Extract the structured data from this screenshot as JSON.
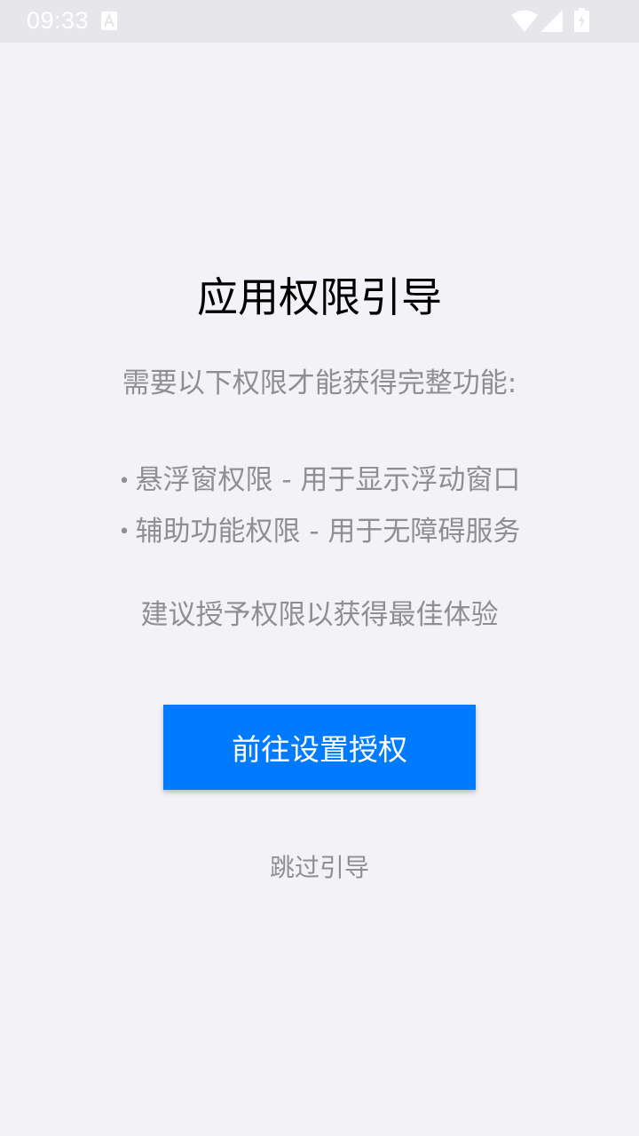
{
  "status_bar": {
    "time": "09:33",
    "icons": [
      "notification-a-icon",
      "wifi-icon",
      "signal-icon",
      "battery-icon"
    ]
  },
  "main": {
    "title": "应用权限引导",
    "subtitle": "需要以下权限才能获得完整功能:",
    "permissions": [
      {
        "bullet": "•",
        "text": "悬浮窗权限 - 用于显示浮动窗口"
      },
      {
        "bullet": "•",
        "text": "辅助功能权限 - 用于无障碍服务"
      }
    ],
    "hint": "建议授予权限以获得最佳体验",
    "primary_button_label": "前往设置授权",
    "skip_label": "跳过引导"
  },
  "colors": {
    "background": "#f2f2f7",
    "accent": "#007aff",
    "secondary_text": "#8e8e93",
    "title_text": "#000000"
  }
}
